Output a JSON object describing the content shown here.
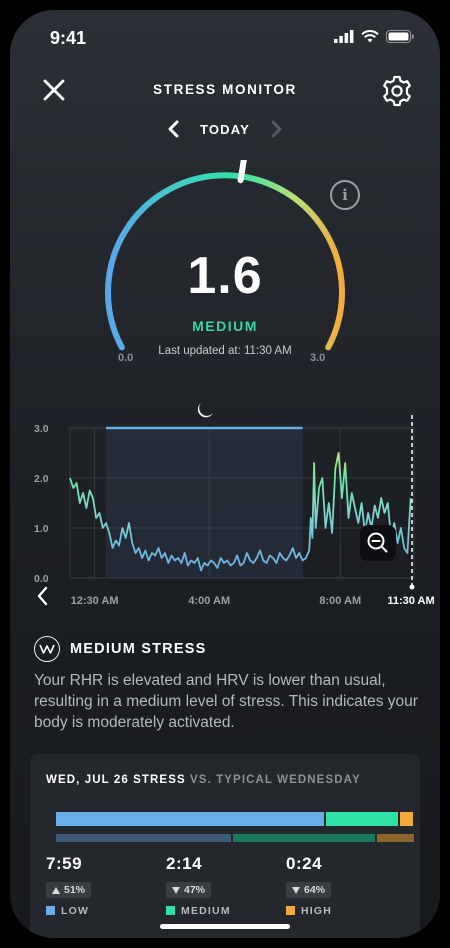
{
  "status_bar": {
    "time": "9:41"
  },
  "header": {
    "title": "STRESS MONITOR"
  },
  "day_nav": {
    "label": "TODAY"
  },
  "gauge": {
    "value": "1.6",
    "level": "MEDIUM",
    "updated": "Last updated at: 11:30 AM",
    "min_label": "0.0",
    "max_label": "3.0",
    "fraction": 0.533
  },
  "chart_data": {
    "type": "line",
    "yticks": [
      "3.0",
      "2.0",
      "1.0",
      "0.0"
    ],
    "ylim": [
      0,
      3
    ],
    "xticks": [
      "12:30 AM",
      "4:00 AM",
      "8:00 AM",
      "11:30 AM"
    ],
    "sleep_band": {
      "start": "1:20 AM",
      "end": "7:20 AM",
      "level": 3.0
    },
    "series": [
      {
        "x_hours": [
          0.0,
          0.1,
          0.2,
          0.3,
          0.4,
          0.5,
          0.6,
          0.7,
          0.8,
          0.9,
          1.0,
          1.1,
          1.2,
          1.3,
          1.4,
          1.5,
          1.6,
          1.7,
          1.8,
          1.9,
          2.0,
          2.1,
          2.2,
          2.3,
          2.4,
          2.5,
          2.6,
          2.7,
          2.8,
          2.9,
          3.0,
          3.1,
          3.2,
          3.3,
          3.4,
          3.5,
          3.6,
          3.7,
          3.8,
          3.9,
          4.0,
          4.1,
          4.2,
          4.3,
          4.4,
          4.5,
          4.6,
          4.7,
          4.8,
          4.9,
          5.0,
          5.1,
          5.2,
          5.3,
          5.4,
          5.5,
          5.6,
          5.7,
          5.8,
          5.9,
          6.0,
          6.1,
          6.2,
          6.3,
          6.4,
          6.5,
          6.6,
          6.7,
          6.8,
          6.9,
          7.0,
          7.1,
          7.2,
          7.3,
          7.35,
          7.4,
          7.45,
          7.5,
          7.6,
          7.7,
          7.8,
          7.9,
          8.0,
          8.1,
          8.2,
          8.3,
          8.4,
          8.5,
          8.6,
          8.7,
          8.8,
          8.9,
          9.0,
          9.1,
          9.2,
          9.3,
          9.4,
          9.5,
          9.6,
          9.7,
          9.8,
          9.9,
          10.0,
          10.1,
          10.2,
          10.3,
          10.4
        ],
        "values": [
          2.0,
          1.8,
          1.9,
          1.5,
          1.7,
          1.4,
          1.75,
          1.6,
          1.2,
          1.3,
          1.0,
          1.1,
          0.9,
          0.6,
          0.75,
          0.65,
          1.0,
          0.8,
          1.1,
          0.7,
          0.5,
          0.6,
          0.4,
          0.55,
          0.35,
          0.5,
          0.45,
          0.6,
          0.4,
          0.5,
          0.3,
          0.45,
          0.35,
          0.4,
          0.3,
          0.5,
          0.25,
          0.35,
          0.3,
          0.4,
          0.15,
          0.3,
          0.25,
          0.35,
          0.3,
          0.2,
          0.4,
          0.3,
          0.35,
          0.25,
          0.3,
          0.45,
          0.25,
          0.3,
          0.5,
          0.35,
          0.3,
          0.4,
          0.55,
          0.35,
          0.3,
          0.45,
          0.4,
          0.3,
          0.5,
          0.4,
          0.35,
          0.45,
          0.6,
          0.4,
          0.5,
          0.35,
          0.4,
          0.55,
          1.2,
          0.8,
          2.3,
          1.0,
          1.8,
          2.0,
          1.0,
          1.5,
          0.9,
          2.2,
          2.5,
          1.6,
          2.3,
          1.2,
          1.7,
          1.4,
          1.1,
          1.5,
          0.9,
          1.3,
          1.0,
          1.45,
          1.2,
          1.6,
          1.3,
          1.5,
          0.8,
          1.1,
          0.7,
          1.0,
          0.6,
          0.5,
          1.6
        ]
      }
    ]
  },
  "summary": {
    "title": "MEDIUM STRESS",
    "body": "Your RHR is elevated and HRV is lower than usual, resulting in a medium level of stress. This indicates your body is moderately activated."
  },
  "comparison": {
    "title_main": "WED, JUL 26 STRESS",
    "title_vs": " VS. TYPICAL WEDNESDAY",
    "today_fractions": {
      "low": 0.749,
      "medium": 0.2,
      "high": 0.038
    },
    "typical_fractions": {
      "low": 0.49,
      "medium": 0.395,
      "high": 0.104
    },
    "colors": {
      "low": "#6aaee8",
      "medium": "#2ee2a5",
      "high": "#f4a93b",
      "low_dim": "#3f5b77",
      "medium_dim": "#1c7a5c",
      "high_dim": "#8b6628"
    },
    "stats": [
      {
        "value": "7:59",
        "direction": "up",
        "pct": "51%",
        "label": "LOW"
      },
      {
        "value": "2:14",
        "direction": "down",
        "pct": "47%",
        "label": "MEDIUM"
      },
      {
        "value": "0:24",
        "direction": "down",
        "pct": "64%",
        "label": "HIGH"
      }
    ]
  }
}
